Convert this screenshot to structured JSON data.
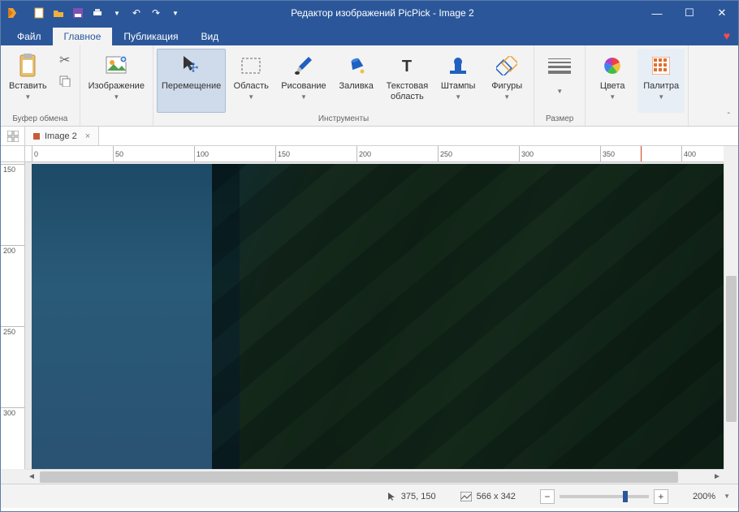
{
  "title": "Редактор изображений PicPick - Image 2",
  "tabs": {
    "file": "Файл",
    "home": "Главное",
    "publish": "Публикация",
    "view": "Вид"
  },
  "ribbon": {
    "clipboard": {
      "paste": "Вставить",
      "group": "Буфер обмена"
    },
    "image": {
      "label": "Изображение"
    },
    "tools": {
      "move": "Перемещение",
      "region": "Область",
      "draw": "Рисование",
      "fill": "Заливка",
      "text": "Текстовая\nобласть",
      "stamps": "Штампы",
      "shapes": "Фигуры",
      "group": "Инструменты"
    },
    "size": {
      "group": "Размер"
    },
    "colors": {
      "label": "Цвета"
    },
    "palette": {
      "label": "Палитра"
    }
  },
  "doc": {
    "name": "Image 2"
  },
  "ruler_h": [
    "0",
    "50",
    "100",
    "150",
    "200",
    "250",
    "300",
    "350",
    "400"
  ],
  "ruler_v": [
    "150",
    "200",
    "250",
    "300"
  ],
  "status": {
    "cursor": "375, 150",
    "size": "566 x 342",
    "zoom": "200%"
  }
}
